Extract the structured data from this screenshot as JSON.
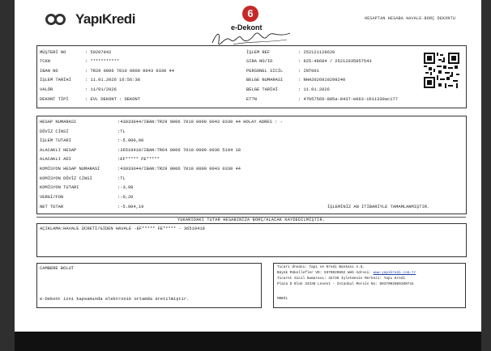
{
  "header": {
    "bank_name": "YapıKredi",
    "seal_text": "6",
    "doc_type": "e-Dekont",
    "signature_text": "Yapı Kredi",
    "doc_title": "HESAPTAN HESABA HAVALE-BORÇ DEKONTU"
  },
  "top_left": [
    {
      "label": "MÜŞTERİ NO",
      "value": ": 59207842"
    },
    {
      "label": "TCKN",
      "value": ": ***********"
    },
    {
      "label": "IBAN NO",
      "value": ": TR29 0006 7010 0000 0043 0330 44"
    },
    {
      "label": "İŞLEM TARİHİ",
      "value": ": 11.01.2026 16:56:38"
    },
    {
      "label": "VALÖR",
      "value": ": 11/01/2026"
    },
    {
      "label": "DEKONT TİPİ",
      "value": ": EVL     DEKONT : DEKONT"
    }
  ],
  "top_right": [
    {
      "label": "İŞLEM REF",
      "value": ": 252121128620"
    },
    {
      "label": "SIRA NO/ID",
      "value": ": 925-48684 / 25212035857543"
    },
    {
      "label": "PERSONEL SİCİL",
      "value": ": INT001"
    },
    {
      "label": "BELGE NUMARASI",
      "value": ": NHA2026019299240"
    },
    {
      "label": "BELGE TARİHİ",
      "value": ": 11.01.2026"
    },
    {
      "label": "ETTN",
      "value": ": 47b57566-885a-8437-e063-1b11330ac177"
    }
  ],
  "detail_rows": [
    {
      "label": "HESAP NUMARASI",
      "value": ":43033044/IBAN:TR29 0006 7010 0000 0043 0330 44   HOLAY ADRES  : -"
    },
    {
      "label": "DÖVİZ CİNSİ",
      "value": ":TL"
    },
    {
      "label": "İŞLEM TUTARI",
      "value": ":-5.000,00"
    },
    {
      "label": "ALACAKLI HESAP",
      "value": ":36519418/IBAN:TR64 0006 7010 0000 0036 5194 18"
    },
    {
      "label": "ALACAKLI ADI",
      "value": ":EF***** FE*****"
    },
    {
      "label": "KOMİSYON HESAP NUMARASI",
      "value": ":43033044/IBAN:TR29 0006 7010 0000 0043 0330 44"
    },
    {
      "label": "KOMİSYON DÖVİZ CİNSİ",
      "value": ":TL"
    },
    {
      "label": "KOMİSYON TUTARI",
      "value": ":-3,98"
    },
    {
      "label": "VERGİ/FON",
      "value": ":-0,20"
    },
    {
      "label": "NET TUTAR",
      "value": ":-5.004,19"
    }
  ],
  "completion_note": "İŞLEMİNİZ AN İTİBARİYLE TAMAMLANMIŞTIR.",
  "banner": "YUKARIDAKİ TUTAR HESABINIZA BORÇ/ALACAK KAYDEDİLMİŞTİR.",
  "description": "AÇIKLAMA:HAVALE ÜCRETİ/GİDEN HAVALE -EF***** FE*****  - 36519418",
  "footer_left": {
    "title": "CAMBERE BOLUT",
    "note": "e-Dekont izni kapsamında elektronik ortamda üretilmiştir."
  },
  "footer_right": {
    "line1": "Ticari Ünvanı: Yapı ve Kredi Bankası A.Ş.",
    "line2_prefix": "Büyük Mükellefler VD: 9370020892 Web Adresi: ",
    "line2_link": "www.yapikredi.com.tr",
    "line3": "Ticaret Sicil Numarası: 32736 İşletmenin Merkezi: Yapı Kredi",
    "line4": "Plaza D Blok 34330 Levent - İstanbul Mersis No: 0937002089200741",
    "mobil": "MOBİL"
  }
}
